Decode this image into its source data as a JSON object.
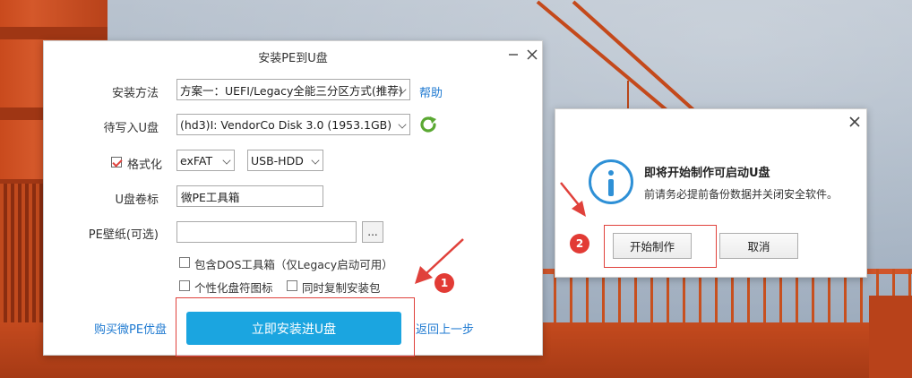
{
  "installer": {
    "title": "安装PE到U盘",
    "method_label": "安装方法",
    "method_value": "方案一：UEFI/Legacy全能三分区方式(推荐)",
    "help_link": "帮助",
    "disk_label": "待写入U盘",
    "disk_value": "(hd3)I: VendorCo Disk 3.0 (1953.1GB)",
    "format_label": "格式化",
    "format_checked": true,
    "fs_value": "exFAT",
    "mode_value": "USB-HDD",
    "volume_label": "U盘卷标",
    "volume_value": "微PE工具箱",
    "wallpaper_label": "PE壁纸(可选)",
    "wallpaper_value": "",
    "browse_label": "...",
    "opt_dos": "包含DOS工具箱（仅Legacy启动可用）",
    "opt_icon": "个性化盘符图标",
    "opt_copy": "同时复制安装包",
    "buy_link": "购买微PE优盘",
    "install_button": "立即安装进U盘",
    "back_link": "返回上一步"
  },
  "confirm": {
    "title": "即将开始制作可启动U盘",
    "message": "前请务必提前备份数据并关闭安全软件。",
    "start_button": "开始制作",
    "cancel_button": "取消"
  },
  "annotations": {
    "step1": "1",
    "step2": "2"
  },
  "colors": {
    "accent": "#1ba5e0",
    "link": "#1f7ad1",
    "annotation": "#e0413b",
    "refresh": "#5aa832"
  }
}
